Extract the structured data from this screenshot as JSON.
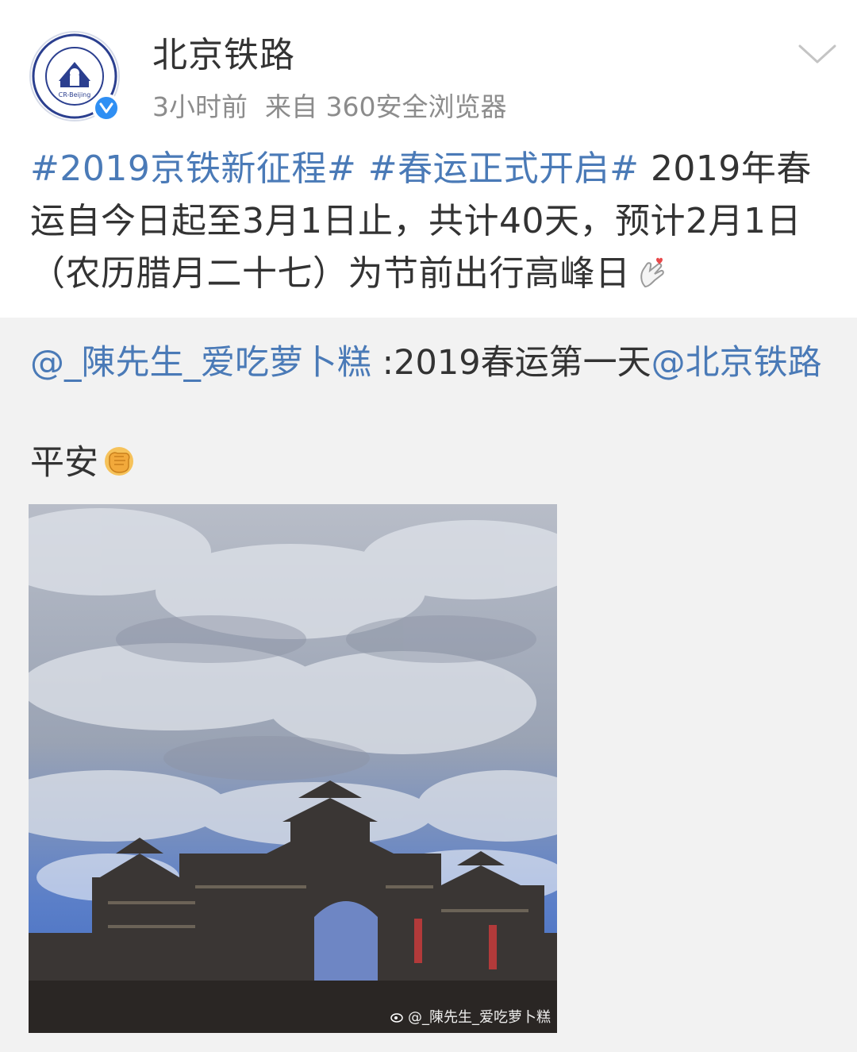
{
  "header": {
    "username": "北京铁路",
    "time": "3小时前",
    "source": "来自 360安全浏览器",
    "avatar_text": "CR-Beijing"
  },
  "post": {
    "hashtag1": "#2019京铁新征程#",
    "hashtag2": "#春运正式开启#",
    "body": " 2019年春运自今日起至3月1日止，共计40天，预计2月1日（农历腊月二十七）为节前出行高峰日",
    "emoji": "finger-heart-emoji"
  },
  "repost": {
    "mention_author": "@_陳先生_爱吃萝卜糕",
    "text": " :2019春运第一天",
    "mention_target": "@北京铁路",
    "line2": "平安",
    "emoji": "fist-emoji",
    "watermark": "@_陳先生_爱吃萝卜糕"
  },
  "colors": {
    "link": "#4a7ab7",
    "verified": "#2f8ff3",
    "repost_bg": "#f2f2f2"
  }
}
